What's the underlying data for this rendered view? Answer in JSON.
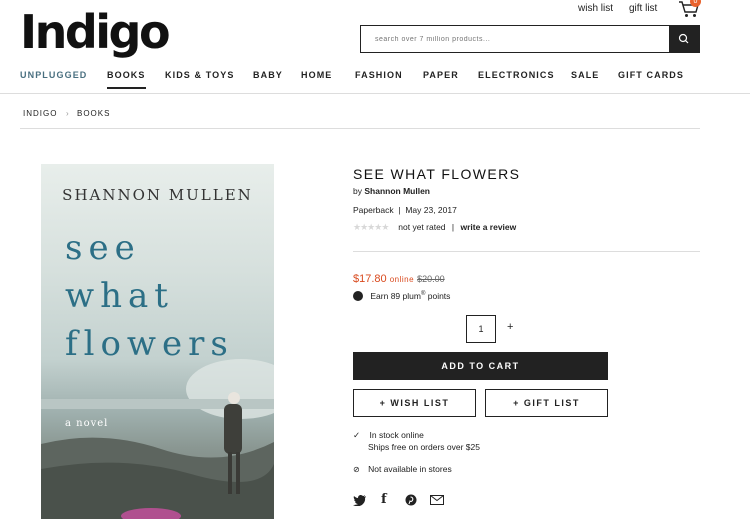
{
  "header": {
    "logo": "Indigo",
    "wish_list": "wish list",
    "gift_list": "gift list",
    "cart_count": "0",
    "search_placeholder": "search over 7 million products..."
  },
  "nav": [
    "UNPLUGGED",
    "BOOKS",
    "KIDS & TOYS",
    "BABY",
    "HOME",
    "FASHION",
    "PAPER",
    "ELECTRONICS",
    "SALE",
    "GIFT CARDS"
  ],
  "breadcrumb": [
    "INDIGO",
    "BOOKS"
  ],
  "cover": {
    "author": "SHANNON MULLEN",
    "title_line1": "see",
    "title_line2": "what",
    "title_line3": "flowers",
    "subtitle": "a novel"
  },
  "product": {
    "title": "SEE WHAT FLOWERS",
    "by": "by",
    "author": "Shannon Mullen",
    "format": "Paperback",
    "separator": "|",
    "date": "May 23, 2017",
    "rating_text": "not yet rated",
    "write_review": "write a review",
    "price": "$17.80",
    "price_label": "online",
    "old_price": "$20.00",
    "plum_text": "Earn 89 plum",
    "plum_sup": "®",
    "plum_suffix": "points",
    "quantity": "1",
    "plus": "+",
    "add_to_cart": "ADD TO CART",
    "wish_list_btn": "+ WISH LIST",
    "gift_list_btn": "+ GIFT LIST",
    "stock_line1": "In stock online",
    "stock_line2": "Ships free on orders over $25",
    "stores": "Not available in stores"
  },
  "colors": {
    "sale": "#d94a1e",
    "dark": "#222222",
    "unplugged": "#4a7080",
    "cart_badge": "#e8612c"
  },
  "icons": [
    "search-icon",
    "cart-icon",
    "star-icon",
    "plum-icon",
    "check-icon",
    "unavailable-icon",
    "twitter-icon",
    "facebook-icon",
    "pinterest-icon",
    "email-icon"
  ]
}
